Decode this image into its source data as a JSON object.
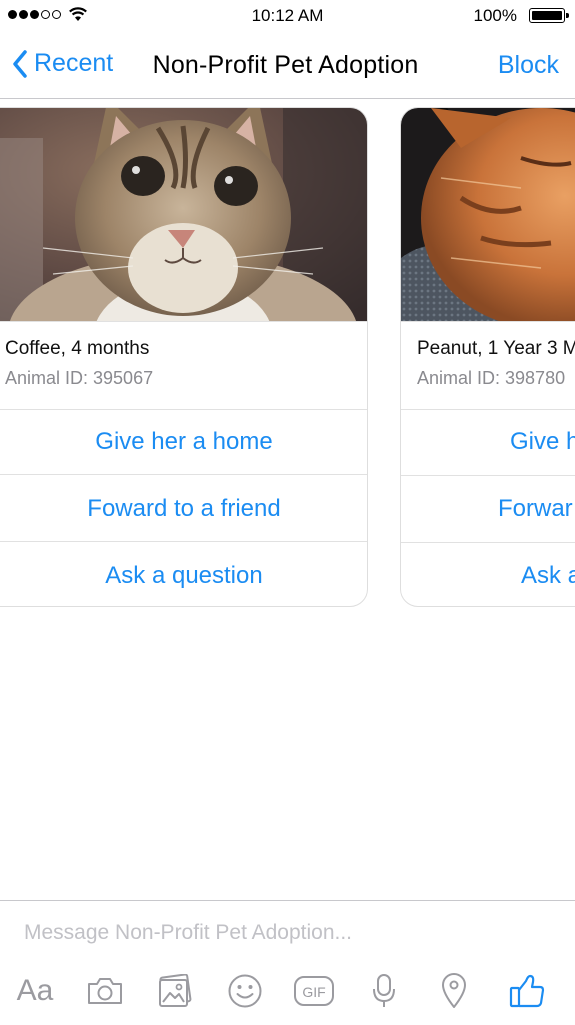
{
  "status_bar": {
    "time": "10:12 AM",
    "battery": "100%"
  },
  "nav": {
    "back_label": "Recent",
    "title": "Non-Profit Pet Adoption",
    "action_label": "Block"
  },
  "accent_color": "#1b8cf2",
  "cards": [
    {
      "name": "Coffee, 4 months",
      "animal_id": "Animal ID: 395067",
      "buttons": [
        "Give her a home",
        "Foward to a friend",
        "Ask a question"
      ]
    },
    {
      "name": "Peanut, 1 Year 3 M",
      "animal_id": "Animal ID: 398780",
      "buttons": [
        "Give h",
        "Forwar",
        "Ask a"
      ]
    }
  ],
  "composer": {
    "placeholder": "Message Non-Profit Pet Adoption...",
    "text_button": "Aa",
    "gif_label": "GIF",
    "icons": [
      "camera-icon",
      "photo-gallery-icon",
      "emoji-icon",
      "gif-icon",
      "microphone-icon",
      "location-pin-icon",
      "thumbs-up-icon"
    ]
  }
}
